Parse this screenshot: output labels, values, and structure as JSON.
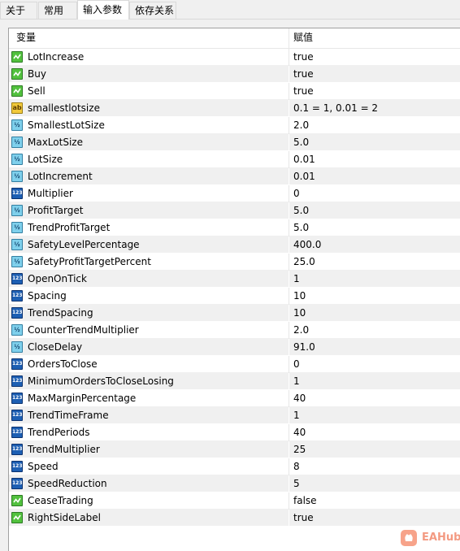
{
  "tabs": [
    {
      "label": "关于",
      "active": false
    },
    {
      "label": "常用",
      "active": false
    },
    {
      "label": "输入参数",
      "active": true
    },
    {
      "label": "依存关系",
      "active": false
    }
  ],
  "table": {
    "col_variable": "变量",
    "col_value": "赋值",
    "rows": [
      {
        "type": "bool",
        "name": "LotIncrease",
        "value": "true"
      },
      {
        "type": "bool",
        "name": "Buy",
        "value": "true"
      },
      {
        "type": "bool",
        "name": "Sell",
        "value": "true"
      },
      {
        "type": "string",
        "name": "smallestlotsize",
        "value": "0.1 = 1, 0.01 = 2"
      },
      {
        "type": "double",
        "name": "SmallestLotSize",
        "value": "2.0"
      },
      {
        "type": "double",
        "name": "MaxLotSize",
        "value": "5.0"
      },
      {
        "type": "double",
        "name": "LotSize",
        "value": "0.01"
      },
      {
        "type": "double",
        "name": "LotIncrement",
        "value": "0.01"
      },
      {
        "type": "int",
        "name": "Multiplier",
        "value": "0"
      },
      {
        "type": "double",
        "name": "ProfitTarget",
        "value": "5.0"
      },
      {
        "type": "double",
        "name": "TrendProfitTarget",
        "value": "5.0"
      },
      {
        "type": "double",
        "name": "SafetyLevelPercentage",
        "value": "400.0"
      },
      {
        "type": "double",
        "name": "SafetyProfitTargetPercent",
        "value": "25.0"
      },
      {
        "type": "int",
        "name": "OpenOnTick",
        "value": "1"
      },
      {
        "type": "int",
        "name": "Spacing",
        "value": "10"
      },
      {
        "type": "int",
        "name": "TrendSpacing",
        "value": "10"
      },
      {
        "type": "double",
        "name": "CounterTrendMultiplier",
        "value": "2.0"
      },
      {
        "type": "double",
        "name": "CloseDelay",
        "value": "91.0"
      },
      {
        "type": "int",
        "name": "OrdersToClose",
        "value": "0"
      },
      {
        "type": "int",
        "name": "MinimumOrdersToCloseLosing",
        "value": "1"
      },
      {
        "type": "int",
        "name": "MaxMarginPercentage",
        "value": "40"
      },
      {
        "type": "int",
        "name": "TrendTimeFrame",
        "value": "1"
      },
      {
        "type": "int",
        "name": "TrendPeriods",
        "value": "40"
      },
      {
        "type": "int",
        "name": "TrendMultiplier",
        "value": "25"
      },
      {
        "type": "int",
        "name": "Speed",
        "value": "8"
      },
      {
        "type": "int",
        "name": "SpeedReduction",
        "value": "5"
      },
      {
        "type": "bool",
        "name": "CeaseTrading",
        "value": "false"
      },
      {
        "type": "bool",
        "name": "RightSideLabel",
        "value": "true"
      }
    ]
  },
  "icon_labels": {
    "string": "ab",
    "double": "½",
    "int": "123"
  },
  "watermark": {
    "text": "EAHub"
  }
}
